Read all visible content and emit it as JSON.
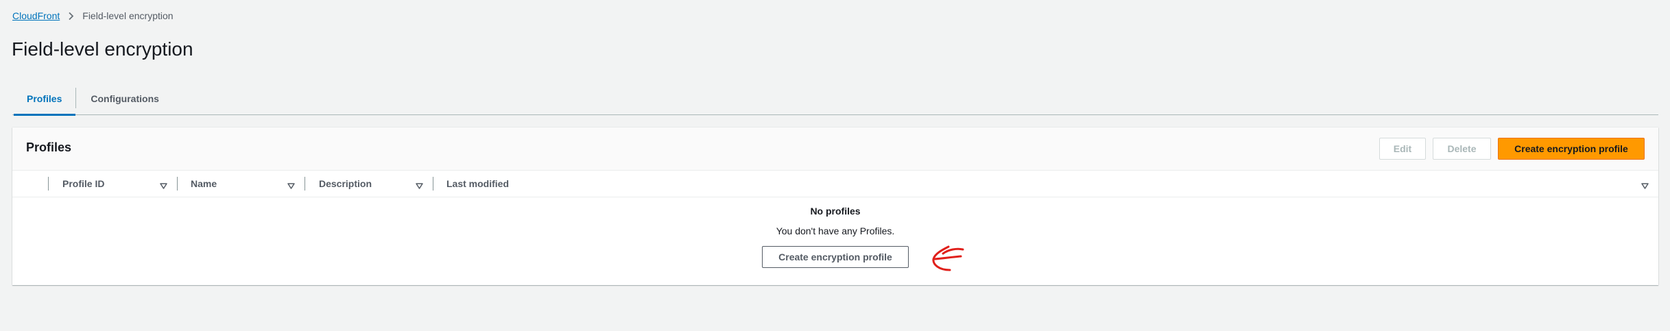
{
  "breadcrumb": {
    "root": "CloudFront",
    "current": "Field-level encryption"
  },
  "page": {
    "title": "Field-level encryption"
  },
  "tabs": [
    {
      "label": "Profiles",
      "active": true
    },
    {
      "label": "Configurations",
      "active": false
    }
  ],
  "panel": {
    "title": "Profiles",
    "actions": {
      "edit": "Edit",
      "delete": "Delete",
      "create": "Create encryption profile"
    },
    "columns": [
      "Profile ID",
      "Name",
      "Description",
      "Last modified"
    ],
    "empty": {
      "title": "No profiles",
      "message": "You don't have any Profiles.",
      "button": "Create encryption profile"
    }
  },
  "colors": {
    "accent": "#0073bb",
    "primary_button": "#ff9900",
    "annotation": "#e0201b"
  },
  "icons": [
    "chevron-right-icon",
    "sort-caret-icon",
    "annotation-arrow-icon"
  ]
}
